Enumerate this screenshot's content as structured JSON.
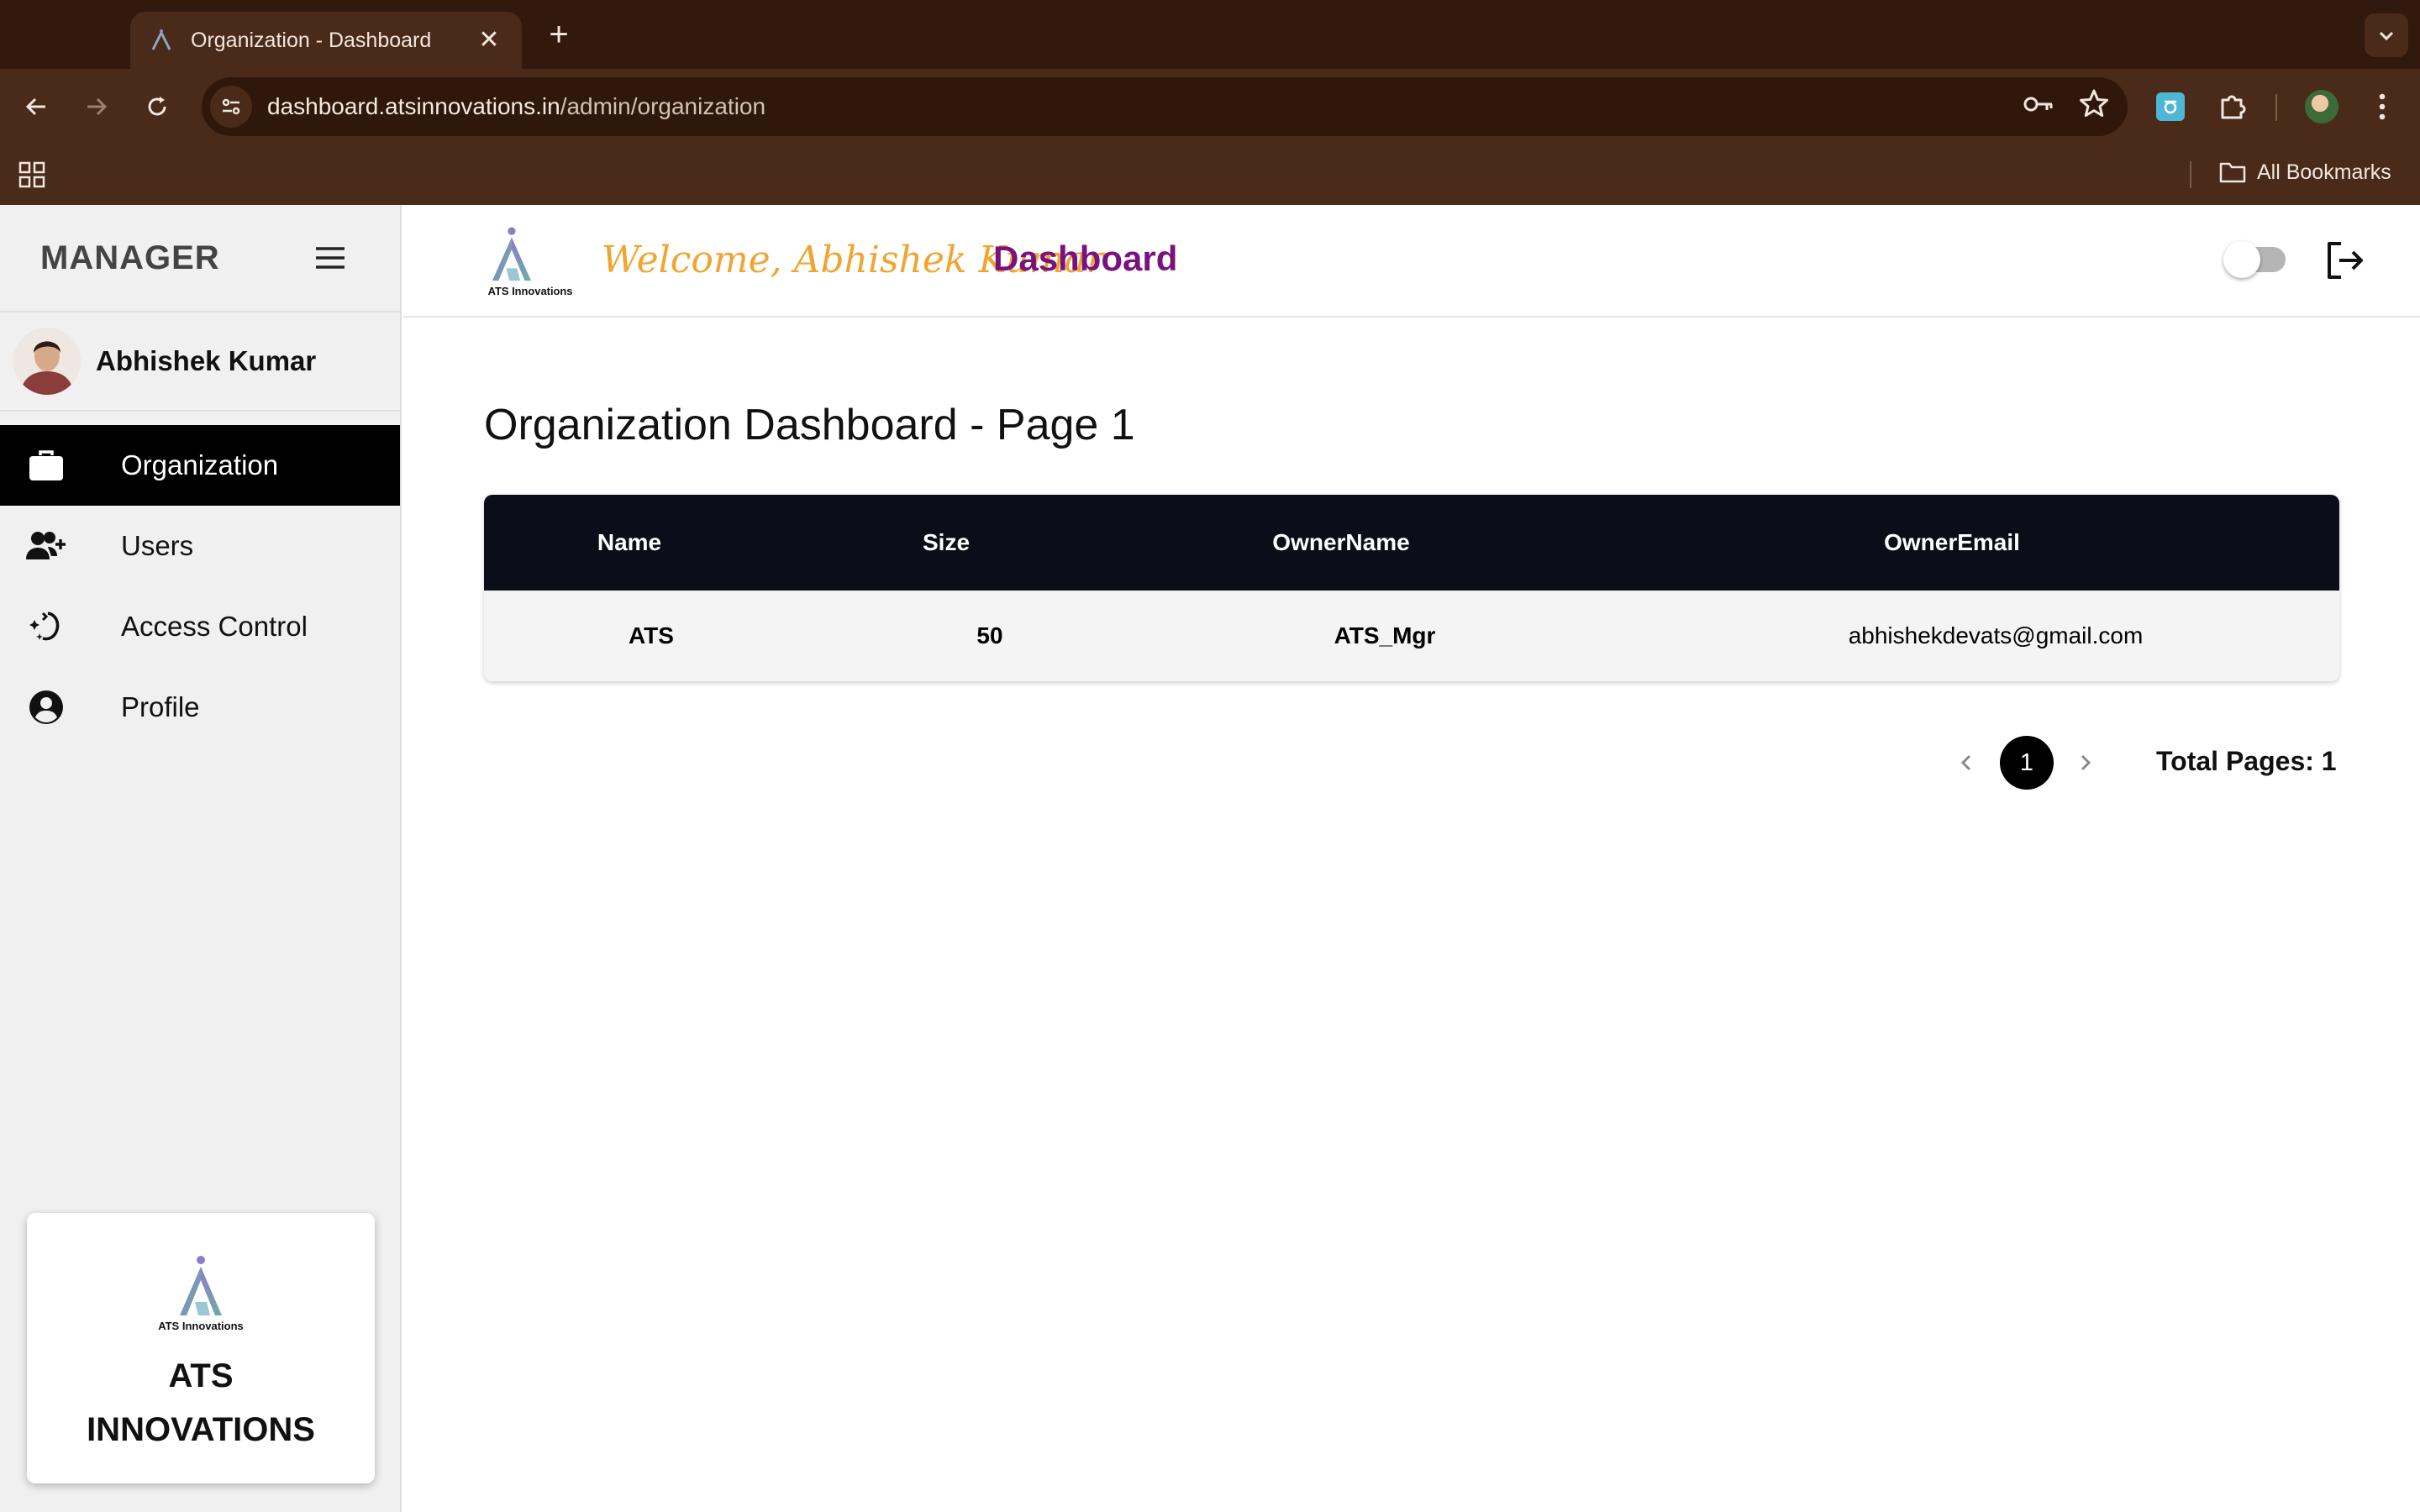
{
  "browser": {
    "tab_title": "Organization - Dashboard",
    "url_host": "dashboard.atsinnovations.in",
    "url_path": "/admin/organization",
    "bookmarks_label": "All Bookmarks"
  },
  "sidebar": {
    "title": "MANAGER",
    "user_name": "Abhishek Kumar",
    "items": [
      {
        "label": "Organization",
        "icon": "briefcase-icon",
        "active": true
      },
      {
        "label": "Users",
        "icon": "add-user-icon",
        "active": false
      },
      {
        "label": "Access Control",
        "icon": "access-control-icon",
        "active": false
      },
      {
        "label": "Profile",
        "icon": "account-circle-icon",
        "active": false
      }
    ],
    "brand_logo_text": "ATS Innovations",
    "brand_name": "ATS INNOVATIONS"
  },
  "header": {
    "logo_text": "ATS Innovations",
    "welcome": "Welcome, Abhishek Kumar",
    "title": "Dashboard"
  },
  "main": {
    "heading": "Organization Dashboard - Page 1",
    "table": {
      "columns": [
        "Name",
        "Size",
        "OwnerName",
        "OwnerEmail"
      ],
      "rows": [
        [
          "ATS",
          "50",
          "ATS_Mgr",
          "abhishekdevats@gmail.com"
        ]
      ]
    },
    "pagination": {
      "current_page": "1",
      "total_label": "Total Pages: 1"
    }
  },
  "colors": {
    "welcome": "#f0a531",
    "dashboard_title": "#7a127d",
    "table_header": "#0b0e19",
    "active_nav": "#000000",
    "chrome": "#4a2a19"
  }
}
